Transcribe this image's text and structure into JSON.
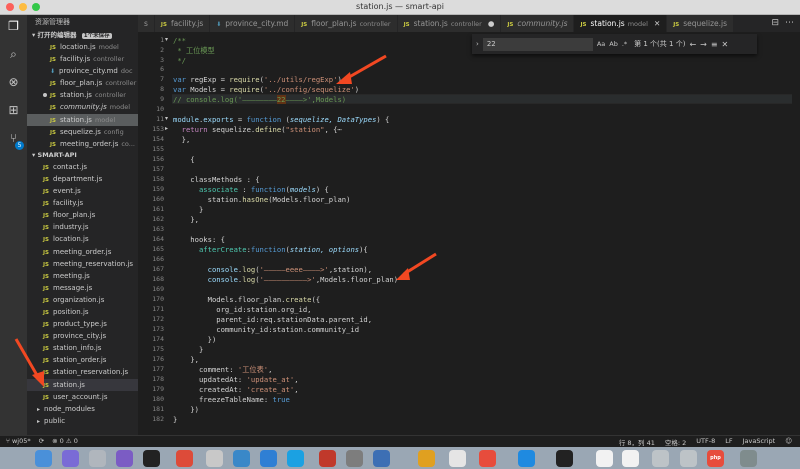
{
  "window": {
    "title": "station.js — smart-api"
  },
  "activity_bar": {
    "scm_badge": "5"
  },
  "sidebar": {
    "title": "资源管理器",
    "open_editors": {
      "label": "打开的编辑器",
      "badge": "1个未保存"
    },
    "open_files": [
      {
        "name": "location.js",
        "desc": "model",
        "type": "js"
      },
      {
        "name": "facility.js",
        "desc": "controller",
        "type": "js"
      },
      {
        "name": "province_city.md",
        "desc": "doc",
        "type": "md"
      },
      {
        "name": "floor_plan.js",
        "desc": "controller",
        "type": "js"
      },
      {
        "name": "station.js",
        "desc": "controller",
        "type": "js",
        "dirty": true
      },
      {
        "name": "community.js",
        "desc": "model",
        "type": "js",
        "italic": true
      },
      {
        "name": "station.js",
        "desc": "model",
        "type": "js",
        "active": true
      },
      {
        "name": "sequelize.js",
        "desc": "config",
        "type": "js"
      },
      {
        "name": "meeting_order.js",
        "desc": "co...",
        "type": "js"
      }
    ],
    "project": {
      "label": "SMART-API"
    },
    "project_files": [
      "contact.js",
      "department.js",
      "event.js",
      "facility.js",
      "floor_plan.js",
      "industry.js",
      "location.js",
      "meeting_order.js",
      "meeting_reservation.js",
      "meeting.js",
      "message.js",
      "organization.js",
      "position.js",
      "product_type.js",
      "province_city.js",
      "station_info.js",
      "station_order.js",
      "station_reservation.js",
      "station.js",
      "user_account.js"
    ],
    "folders": [
      "node_modules",
      "public"
    ]
  },
  "tabs": [
    {
      "name": "s",
      "desc": "",
      "type": "js"
    },
    {
      "name": "facility.js",
      "desc": "",
      "type": "js"
    },
    {
      "name": "province_city.md",
      "desc": "",
      "type": "md"
    },
    {
      "name": "floor_plan.js",
      "desc": "controller",
      "type": "js"
    },
    {
      "name": "station.js",
      "desc": "controller",
      "type": "js",
      "dirty": true
    },
    {
      "name": "community.js",
      "desc": "",
      "type": "js",
      "italic": true
    },
    {
      "name": "station.js",
      "desc": "model",
      "type": "js",
      "active": true
    },
    {
      "name": "sequelize.js",
      "desc": "",
      "type": "js"
    }
  ],
  "find": {
    "value": "22",
    "result": "第 1 个(共 1 个)",
    "opt_case": "Aa",
    "opt_word": "Ab",
    "opt_regex": ".*"
  },
  "editor": {
    "line_numbers": [
      "1",
      "2",
      "3",
      "4",
      "5",
      "6",
      "7",
      "8",
      "9",
      "10",
      "11",
      "153",
      "154",
      "155",
      "156",
      "157",
      "158",
      "159",
      "160",
      "161",
      "162",
      "163",
      "164",
      "165",
      "166",
      "167",
      "168",
      "169",
      "170",
      "171",
      "172",
      "173",
      "174",
      "175",
      "176",
      "177",
      "178",
      "179",
      "180",
      "181",
      "182",
      "183"
    ],
    "comment_doc_start": "/**",
    "comment_title": " * 工位模型",
    "comment_doc_end": " */",
    "l7_prefix": "var regExp = require(",
    "l7_str": "'../utils/regExp'",
    "l7_suffix": ");",
    "l8_prefix": "var Models = require(",
    "l8_str": "'../config/sequelize'",
    "l8_suffix": ")",
    "l9_a": "// console.log('————————",
    "l9_b": "22",
    "l9_c": "————>',Models)",
    "l11": "module.exports = function (sequelize, DataTypes) {",
    "l12": "  return sequelize.define(\"station\", {",
    "l13": "  },",
    "l15": "    {",
    "l17": "    classMethods : {",
    "l18": "      associate : function(models) {",
    "l19": "        station.hasOne(Models.floor_plan)",
    "l20": "      }",
    "l21": "    },",
    "l23": "    hooks: {",
    "l24": "      afterCreate:function(station, options){",
    "l26": "        console.log('—————eeee————>',station),",
    "l27": "        console.log('——————————>',Models.floor_plan)",
    "l29": "        Models.floor_plan.create({",
    "l30": "          org_id:station.org_id,",
    "l31": "          parent_id:req.stationData.parent_id,",
    "l32": "          community_id:station.community_id",
    "l33": "        })",
    "l34": "      }",
    "l35": "    },",
    "l36": "      comment: '工位表',",
    "l37": "      updatedAt: 'update_at',",
    "l38": "      createdAt: 'create_at',",
    "l39": "      freezeTableName: true",
    "l40": "    })",
    "l41": "}"
  },
  "statusbar": {
    "branch": "wj05*",
    "errors": "0",
    "warnings": "0",
    "position": "行 8，列 41",
    "spaces": "空格: 2",
    "encoding": "UTF-8",
    "eol": "LF",
    "language": "JavaScript"
  },
  "dock": {
    "php_label": "php"
  },
  "colors": {
    "accent": "#007acc",
    "arrow": "#f24822"
  }
}
